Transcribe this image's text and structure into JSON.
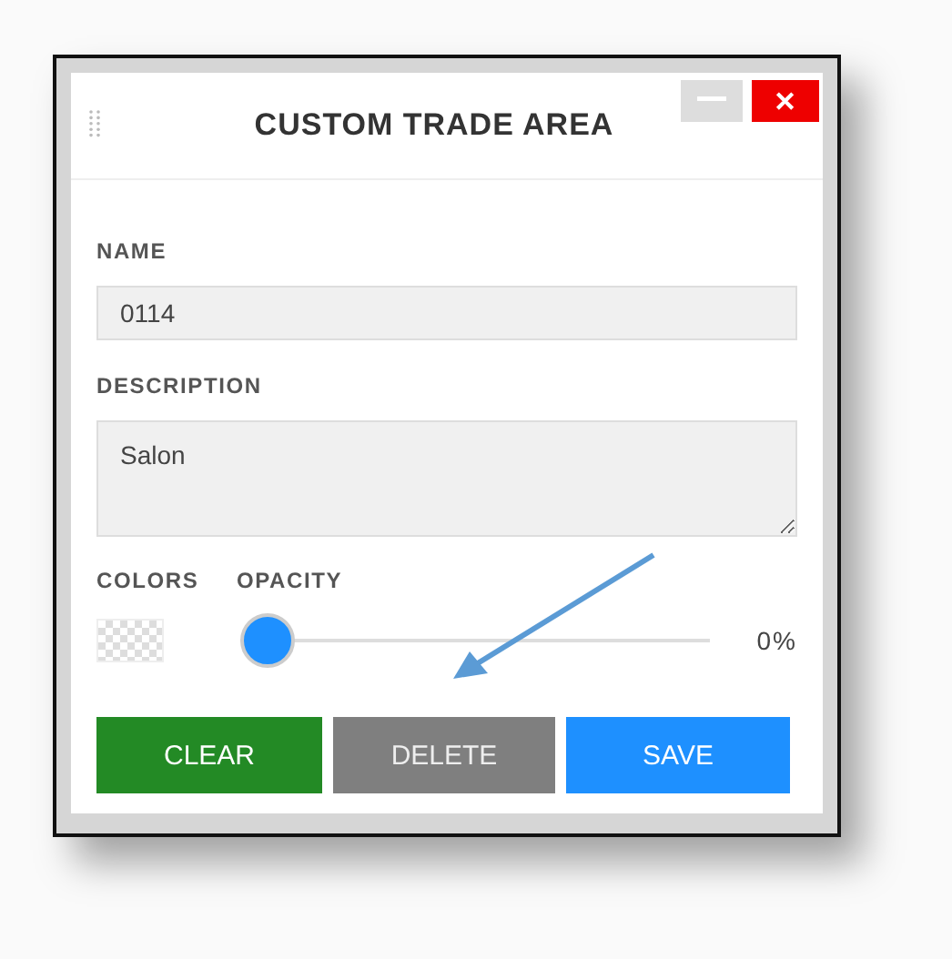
{
  "window": {
    "title": "CUSTOM TRADE AREA",
    "close_label": "✕"
  },
  "name": {
    "label": "NAME",
    "value": "0114"
  },
  "description": {
    "label": "DESCRIPTION",
    "value": "Salon"
  },
  "colors": {
    "label": "COLORS"
  },
  "opacity": {
    "label": "OPACITY",
    "level": 0,
    "reading": "0%"
  },
  "buttons": [
    {
      "label": "CLEAR",
      "kind": "clear"
    },
    {
      "label": "DELETE",
      "kind": "delete"
    },
    {
      "label": "SAVE",
      "kind": "save"
    }
  ]
}
